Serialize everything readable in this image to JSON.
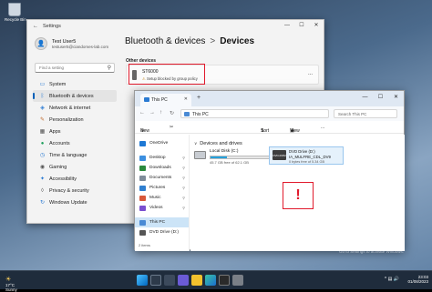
{
  "desktop": {
    "recycle_bin": "Recycle Bin"
  },
  "settings": {
    "title": "Settings",
    "user": {
      "name": "Test User5",
      "email": "testuser5@ciandomes-lab.com"
    },
    "search_placeholder": "Find a setting",
    "nav": [
      {
        "label": "System",
        "icon": "monitor-icon",
        "active": false
      },
      {
        "label": "Bluetooth & devices",
        "icon": "bluetooth-icon",
        "active": true
      },
      {
        "label": "Network & internet",
        "icon": "network-icon",
        "active": false
      },
      {
        "label": "Personalization",
        "icon": "brush-icon",
        "active": false
      },
      {
        "label": "Apps",
        "icon": "apps-icon",
        "active": false
      },
      {
        "label": "Accounts",
        "icon": "person-icon",
        "active": false
      },
      {
        "label": "Time & language",
        "icon": "globe-clock-icon",
        "active": false
      },
      {
        "label": "Gaming",
        "icon": "gamepad-icon",
        "active": false
      },
      {
        "label": "Accessibility",
        "icon": "accessibility-icon",
        "active": false
      },
      {
        "label": "Privacy & security",
        "icon": "shield-icon",
        "active": false
      },
      {
        "label": "Windows Update",
        "icon": "update-icon",
        "active": false
      }
    ],
    "breadcrumb": {
      "parent": "Bluetooth & devices",
      "sep": ">",
      "current": "Devices"
    },
    "section_title": "Other devices",
    "device": {
      "name": "ST6000",
      "status": "Setup blocked by group policy",
      "more": "..."
    },
    "window_controls": {
      "minimize": "—",
      "maximize": "☐",
      "close": "✕"
    }
  },
  "explorer": {
    "tab": {
      "label": "This PC",
      "close": "✕"
    },
    "new_tab": "+",
    "window_controls": {
      "minimize": "—",
      "maximize": "☐",
      "close": "✕"
    },
    "address": {
      "path": "This PC",
      "search_placeholder": "Search This PC"
    },
    "nav_buttons": {
      "back": "←",
      "forward": "→",
      "up": "↑",
      "refresh": "↻"
    },
    "commands": {
      "new": "New",
      "cut": "✂",
      "sort": "Sort",
      "view": "View",
      "more": "..."
    },
    "sidebar": [
      {
        "label": "OneDrive",
        "color": "#1e78d4",
        "pinned": false,
        "selected": false
      },
      {
        "label": "Desktop",
        "color": "#3c8fe0",
        "pinned": true,
        "selected": false
      },
      {
        "label": "Downloads",
        "color": "#2b8a3e",
        "pinned": true,
        "selected": false
      },
      {
        "label": "Documents",
        "color": "#7f8c9a",
        "pinned": true,
        "selected": false
      },
      {
        "label": "Pictures",
        "color": "#2f7fd0",
        "pinned": true,
        "selected": false
      },
      {
        "label": "Music",
        "color": "#d8583a",
        "pinned": true,
        "selected": false
      },
      {
        "label": "Videos",
        "color": "#7a4fcf",
        "pinned": true,
        "selected": false
      },
      {
        "label": "This PC",
        "color": "#4a8ad4",
        "pinned": false,
        "selected": true
      },
      {
        "label": "DVD Drive (D:)",
        "color": "#555555",
        "pinned": false,
        "selected": false
      }
    ],
    "group_header": "Devices and drives",
    "local_disk": {
      "name": "Local Disk (C:)",
      "free": "45.7 GB free of 62.1 GB",
      "used_fraction": 0.26
    },
    "dvd": {
      "name": "DVD Drive (D:)",
      "label": "IA_MULFRE_CDL_DV9",
      "free": "0 bytes free of 5.34 GB",
      "badge": "DVD-ROM"
    },
    "warning_mark": "!",
    "status_bar": "2 items"
  },
  "watermark": {
    "line1": "Activate Windows",
    "line2": "Go to Settings to activate Windows."
  },
  "taskbar": {
    "weather": {
      "temp": "17°C",
      "desc": "Sunny"
    },
    "time": "23:03",
    "date": "01/08/2023"
  }
}
